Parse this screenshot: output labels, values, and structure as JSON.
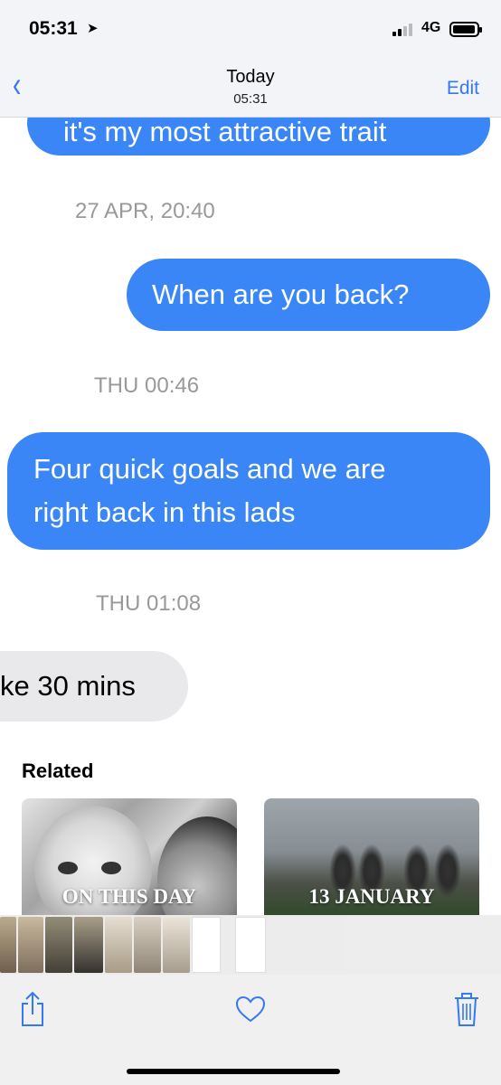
{
  "status": {
    "time": "05:31",
    "network": "4G"
  },
  "nav": {
    "title": "Today",
    "subtitle": "05:31",
    "edit_label": "Edit"
  },
  "messages": {
    "partial_top": "it's my most attractive trait",
    "stamp1": "27 APR, 20:40",
    "msg1": "When are you back?",
    "stamp2": "THU 00:46",
    "msg2_line1": "Four quick goals and we are",
    "msg2_line2": "right back in this lads",
    "stamp3": "THU 01:08",
    "incoming_partial": "ke 30 mins"
  },
  "related": {
    "heading": "Related",
    "cards": [
      {
        "label": "ON THIS DAY"
      },
      {
        "label": "13 JANUARY"
      }
    ]
  },
  "colors": {
    "accent": "#3478f6",
    "bubble_blue": "#3a86f7",
    "bubble_gray": "#e9e9eb"
  },
  "icons": [
    "location-arrow-icon",
    "signal-icon",
    "battery-icon",
    "back-chevron-icon",
    "share-icon",
    "heart-icon",
    "trash-icon"
  ]
}
